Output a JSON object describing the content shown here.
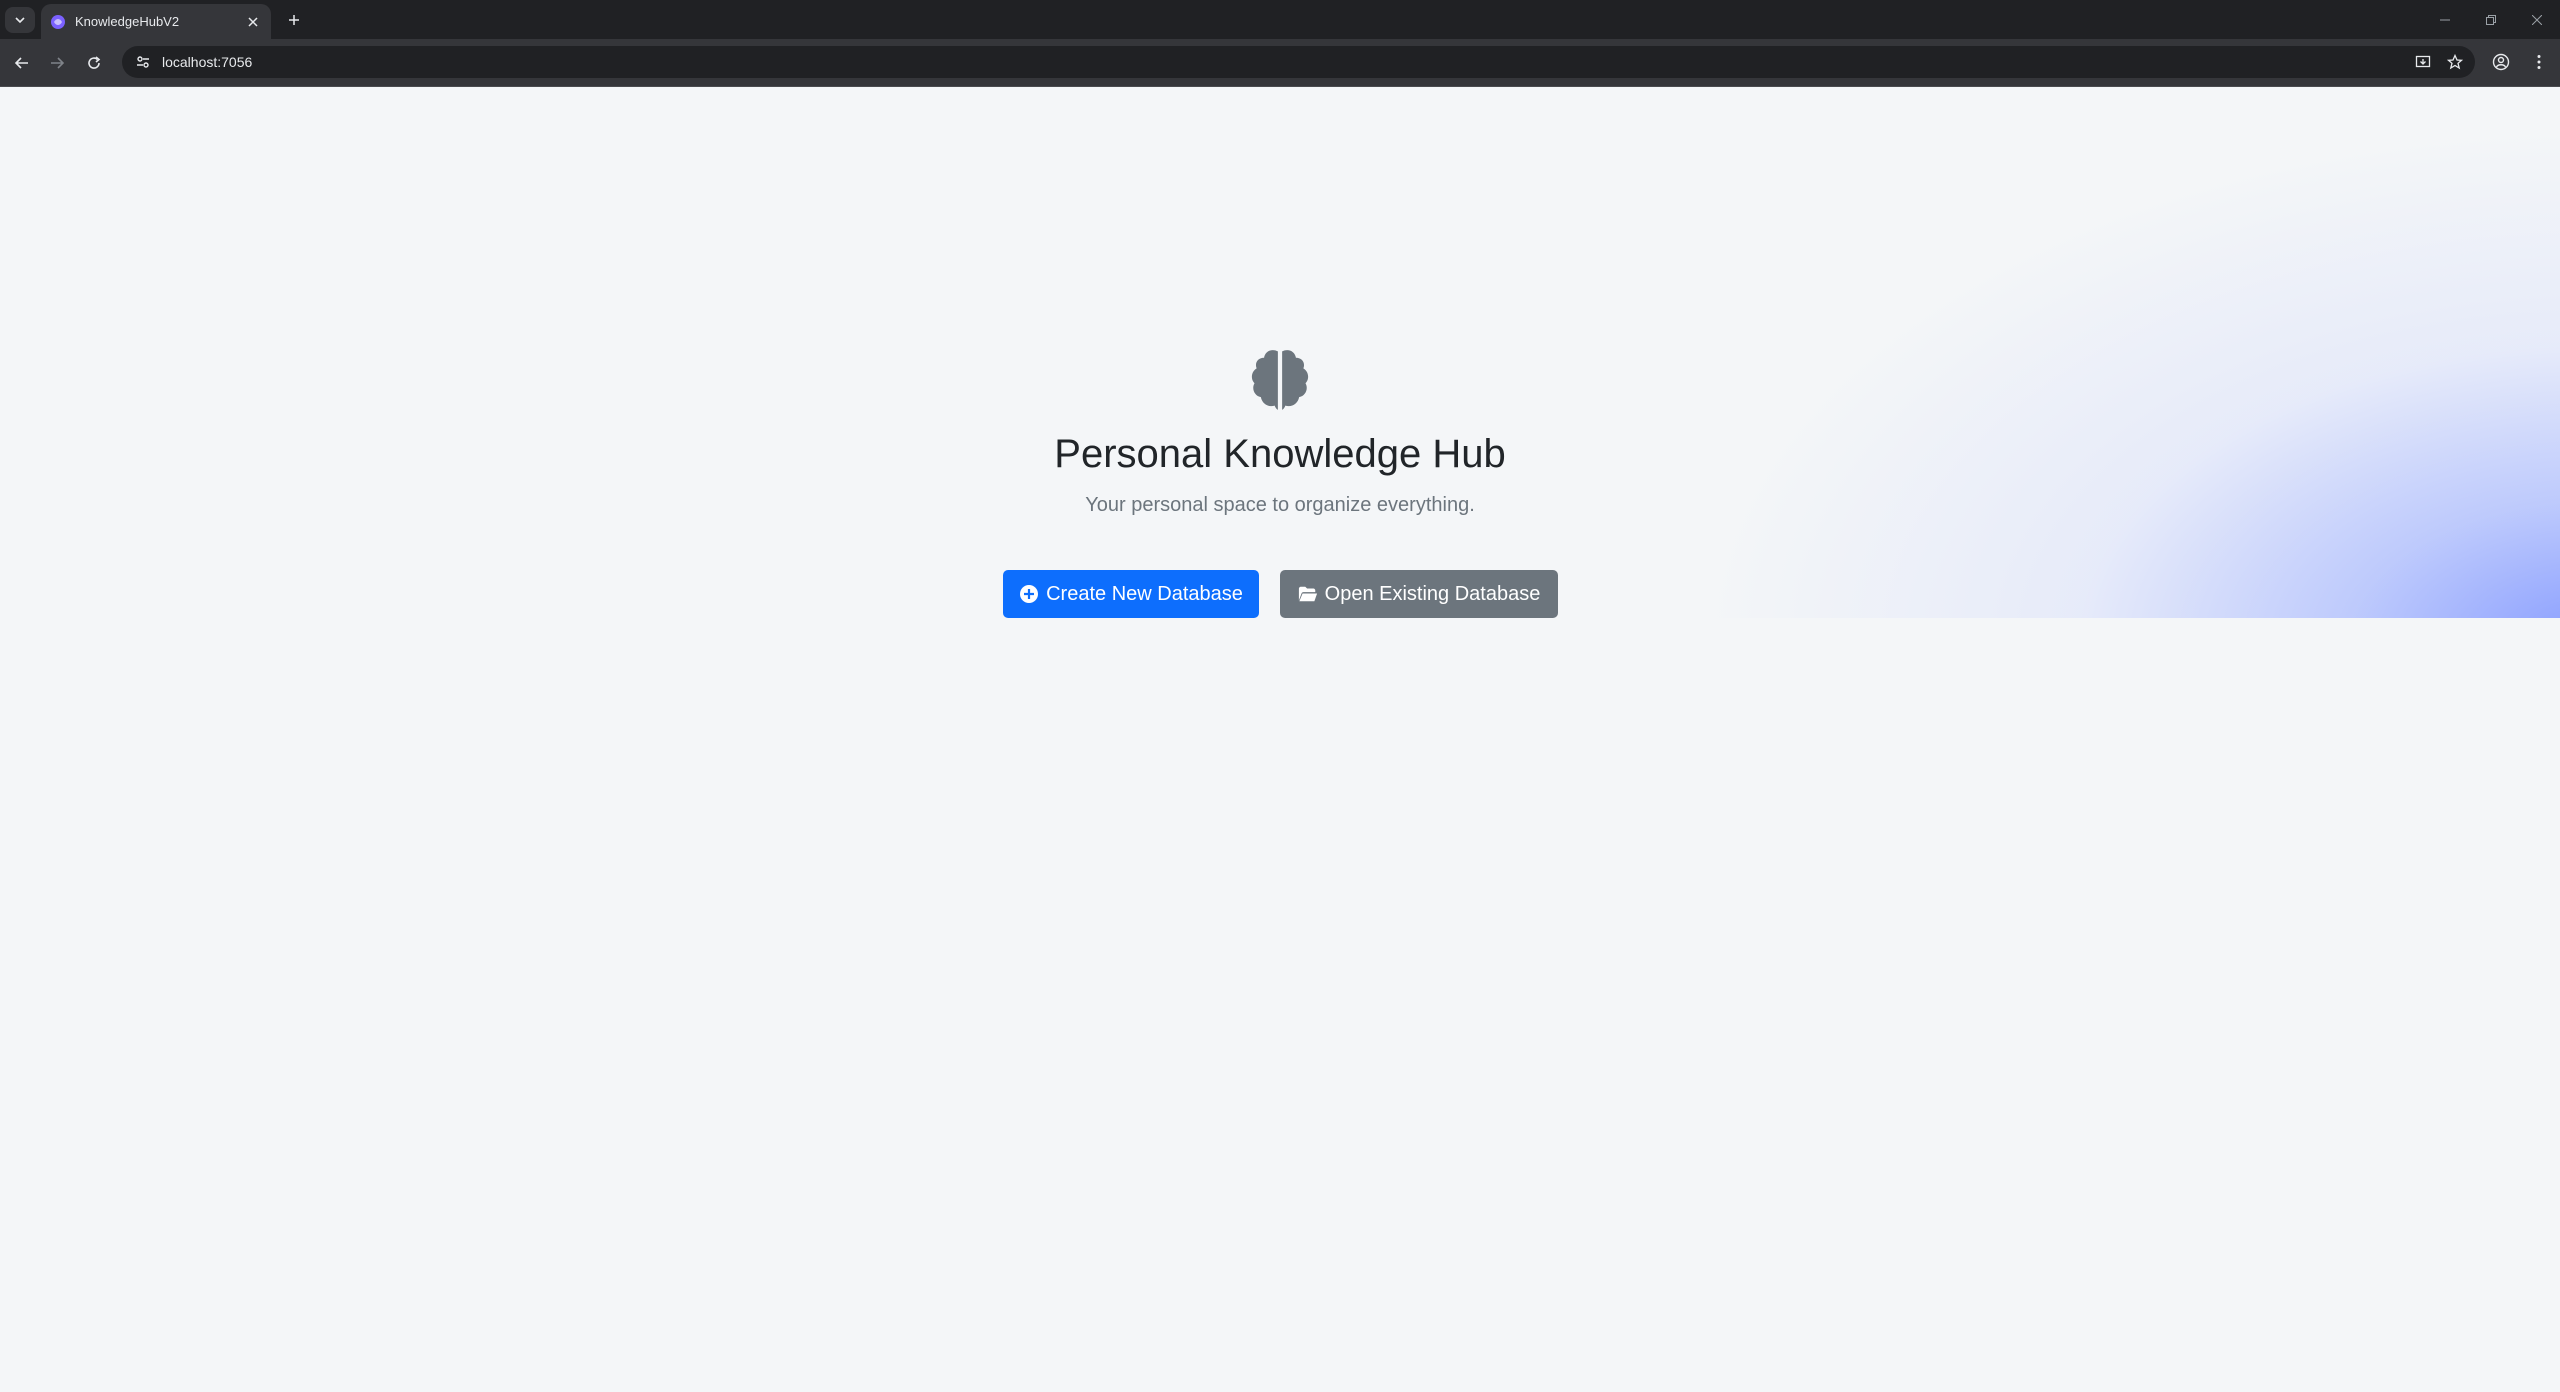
{
  "browser": {
    "tab": {
      "title": "KnowledgeHubV2"
    },
    "address_bar": {
      "url": "localhost:7056"
    }
  },
  "page": {
    "title": "Personal Knowledge Hub",
    "subtitle": "Your personal space to organize everything.",
    "buttons": {
      "create": {
        "label": "Create New Database",
        "icon": "plus-circle-icon",
        "color": "#0d6efd"
      },
      "open": {
        "label": "Open Existing Database",
        "icon": "folder-open-icon",
        "color": "#6c757d"
      }
    },
    "brand_icon": "brain-icon",
    "colors": {
      "icon": "#6c757d",
      "title": "#212529",
      "subtitle": "#6c757d",
      "background": "#f4f6f8",
      "gradient_accent": "#8096ff"
    }
  }
}
